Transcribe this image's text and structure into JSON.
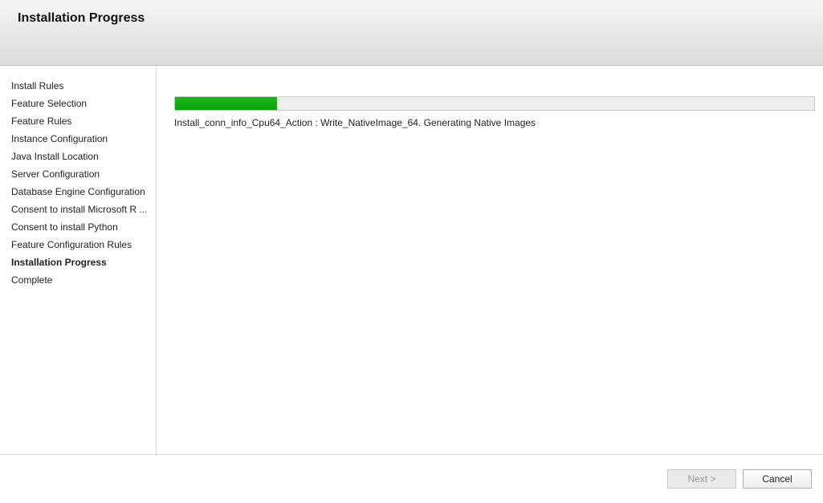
{
  "header": {
    "title": "Installation Progress"
  },
  "sidebar": {
    "items": [
      {
        "label": "Install Rules",
        "current": false
      },
      {
        "label": "Feature Selection",
        "current": false
      },
      {
        "label": "Feature Rules",
        "current": false
      },
      {
        "label": "Instance Configuration",
        "current": false
      },
      {
        "label": "Java Install Location",
        "current": false
      },
      {
        "label": "Server Configuration",
        "current": false
      },
      {
        "label": "Database Engine Configuration",
        "current": false
      },
      {
        "label": "Consent to install Microsoft R ...",
        "current": false
      },
      {
        "label": "Consent to install Python",
        "current": false
      },
      {
        "label": "Feature Configuration Rules",
        "current": false
      },
      {
        "label": "Installation Progress",
        "current": true
      },
      {
        "label": "Complete",
        "current": false
      }
    ]
  },
  "main": {
    "progress_percent": 16,
    "status_text": "Install_conn_info_Cpu64_Action : Write_NativeImage_64. Generating Native Images"
  },
  "footer": {
    "next_label": "Next >",
    "cancel_label": "Cancel",
    "next_enabled": false
  },
  "colors": {
    "progress_fill": "#0aa20a"
  }
}
